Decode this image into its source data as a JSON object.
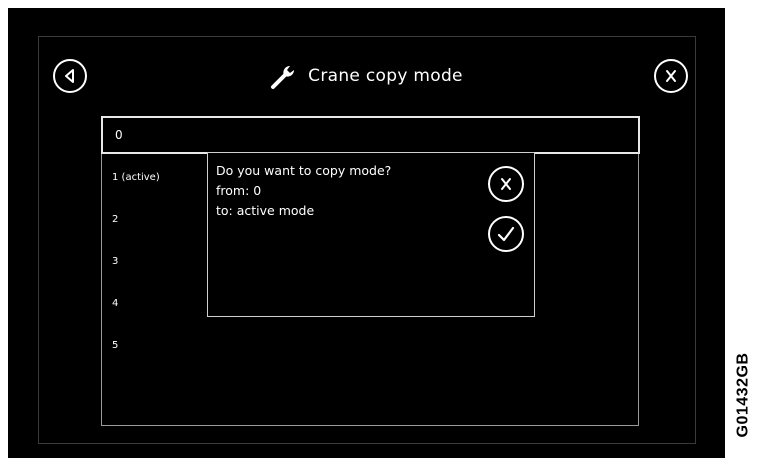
{
  "header": {
    "title": "Crane copy mode",
    "back_icon": "back-arrow-icon",
    "close_icon": "close-icon",
    "title_icon": "wrench-icon"
  },
  "mode_list": {
    "selected": "0",
    "items": [
      "1 (active)",
      "2",
      "3",
      "4",
      "5"
    ]
  },
  "dialog": {
    "question": "Do you want to copy mode?",
    "from_line": "from: 0",
    "to_line": "to: active mode",
    "cancel_icon": "close-icon",
    "confirm_icon": "checkmark-icon"
  },
  "figure_code": "G01432GB",
  "colors": {
    "background": "#000000",
    "foreground": "#ffffff",
    "border": "#9a9a9a"
  }
}
